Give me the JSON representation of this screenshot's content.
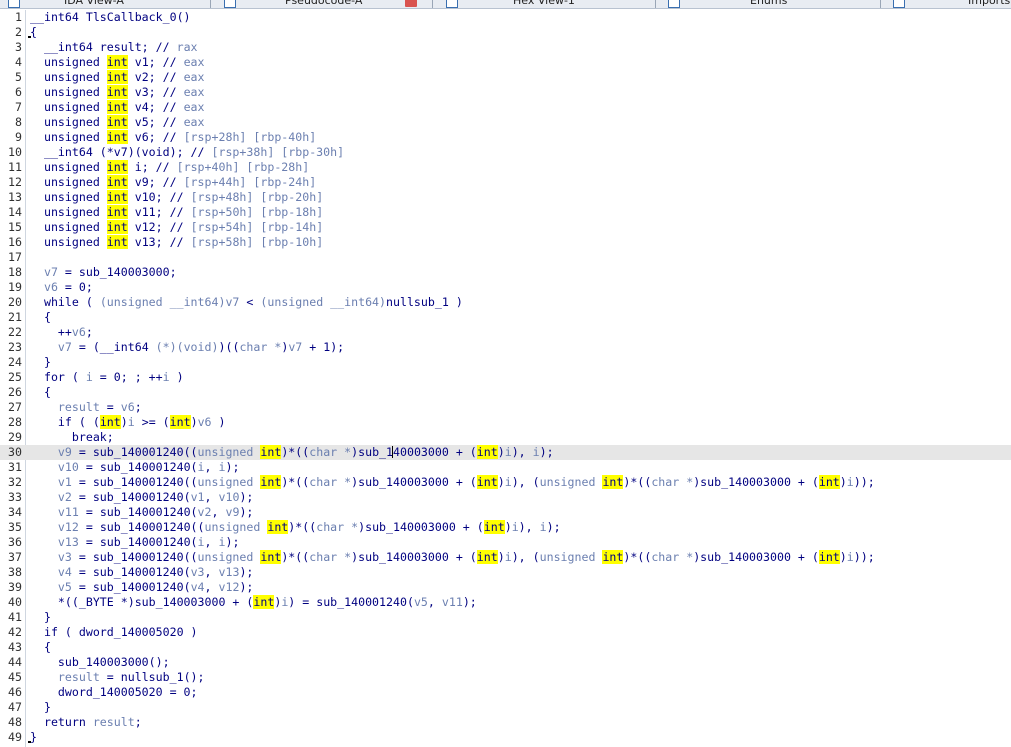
{
  "tabs": [
    {
      "label": "IDA View-A"
    },
    {
      "label": "Pseudocode-A"
    },
    {
      "label": "Hex View-1"
    },
    {
      "label": "Enums"
    },
    {
      "label": "Imports"
    }
  ],
  "highlighted_line": 30,
  "code_lines": [
    [
      [
        "k",
        "__int64 TlsCallback_0()"
      ]
    ],
    [
      [
        "k",
        "{"
      ]
    ],
    [
      [
        "k",
        "  __int64 result; // "
      ],
      [
        "v",
        "rax"
      ]
    ],
    [
      [
        "k",
        "  unsigned "
      ],
      [
        "i",
        "int"
      ],
      [
        "k",
        " v1; // "
      ],
      [
        "v",
        "eax"
      ]
    ],
    [
      [
        "k",
        "  unsigned "
      ],
      [
        "i",
        "int"
      ],
      [
        "k",
        " v2; // "
      ],
      [
        "v",
        "eax"
      ]
    ],
    [
      [
        "k",
        "  unsigned "
      ],
      [
        "i",
        "int"
      ],
      [
        "k",
        " v3; // "
      ],
      [
        "v",
        "eax"
      ]
    ],
    [
      [
        "k",
        "  unsigned "
      ],
      [
        "i",
        "int"
      ],
      [
        "k",
        " v4; // "
      ],
      [
        "v",
        "eax"
      ]
    ],
    [
      [
        "k",
        "  unsigned "
      ],
      [
        "i",
        "int"
      ],
      [
        "k",
        " v5; // "
      ],
      [
        "v",
        "eax"
      ]
    ],
    [
      [
        "k",
        "  unsigned "
      ],
      [
        "i",
        "int"
      ],
      [
        "k",
        " v6; // "
      ],
      [
        "v",
        "[rsp+28h] [rbp-40h]"
      ]
    ],
    [
      [
        "k",
        "  __int64 (*v7)(void); // "
      ],
      [
        "v",
        "[rsp+38h] [rbp-30h]"
      ]
    ],
    [
      [
        "k",
        "  unsigned "
      ],
      [
        "i",
        "int"
      ],
      [
        "k",
        " i; // "
      ],
      [
        "v",
        "[rsp+40h] [rbp-28h]"
      ]
    ],
    [
      [
        "k",
        "  unsigned "
      ],
      [
        "i",
        "int"
      ],
      [
        "k",
        " v9; // "
      ],
      [
        "v",
        "[rsp+44h] [rbp-24h]"
      ]
    ],
    [
      [
        "k",
        "  unsigned "
      ],
      [
        "i",
        "int"
      ],
      [
        "k",
        " v10; // "
      ],
      [
        "v",
        "[rsp+48h] [rbp-20h]"
      ]
    ],
    [
      [
        "k",
        "  unsigned "
      ],
      [
        "i",
        "int"
      ],
      [
        "k",
        " v11; // "
      ],
      [
        "v",
        "[rsp+50h] [rbp-18h]"
      ]
    ],
    [
      [
        "k",
        "  unsigned "
      ],
      [
        "i",
        "int"
      ],
      [
        "k",
        " v12; // "
      ],
      [
        "v",
        "[rsp+54h] [rbp-14h]"
      ]
    ],
    [
      [
        "k",
        "  unsigned "
      ],
      [
        "i",
        "int"
      ],
      [
        "k",
        " v13; // "
      ],
      [
        "v",
        "[rsp+58h] [rbp-10h]"
      ]
    ],
    [
      [
        "k",
        ""
      ]
    ],
    [
      [
        "v",
        "  v7"
      ],
      [
        "k",
        " = sub_140003000;"
      ]
    ],
    [
      [
        "v",
        "  v6"
      ],
      [
        "k",
        " = 0;"
      ]
    ],
    [
      [
        "k",
        "  while ( "
      ],
      [
        "v",
        "(unsigned __int64)v7"
      ],
      [
        "k",
        " < "
      ],
      [
        "v",
        "(unsigned __int64)"
      ],
      [
        "k",
        "nullsub_1 )"
      ]
    ],
    [
      [
        "k",
        "  {"
      ]
    ],
    [
      [
        "k",
        "    ++"
      ],
      [
        "v",
        "v6"
      ],
      [
        "k",
        ";"
      ]
    ],
    [
      [
        "v",
        "    v7"
      ],
      [
        "k",
        " = (__int64 "
      ],
      [
        "v",
        "(*)(void)"
      ],
      [
        "k",
        ")(("
      ],
      [
        "v",
        "char *"
      ],
      [
        "k",
        ")"
      ],
      [
        "v",
        "v7"
      ],
      [
        "k",
        " + 1);"
      ]
    ],
    [
      [
        "k",
        "  }"
      ]
    ],
    [
      [
        "k",
        "  for ( "
      ],
      [
        "v",
        "i"
      ],
      [
        "k",
        " = 0; ; ++"
      ],
      [
        "v",
        "i"
      ],
      [
        "k",
        " )"
      ]
    ],
    [
      [
        "k",
        "  {"
      ]
    ],
    [
      [
        "v",
        "    result"
      ],
      [
        "k",
        " = "
      ],
      [
        "v",
        "v6"
      ],
      [
        "k",
        ";"
      ]
    ],
    [
      [
        "k",
        "    if ( ("
      ],
      [
        "i",
        "int"
      ],
      [
        "k",
        ")"
      ],
      [
        "v",
        "i"
      ],
      [
        "k",
        " >= ("
      ],
      [
        "i",
        "int"
      ],
      [
        "k",
        ")"
      ],
      [
        "v",
        "v6"
      ],
      [
        "k",
        " )"
      ]
    ],
    [
      [
        "k",
        "      break;"
      ]
    ],
    [
      [
        "v",
        "    v9"
      ],
      [
        "k",
        " = sub_140001240(("
      ],
      [
        "v",
        "unsigned "
      ],
      [
        "i",
        "int"
      ],
      [
        "k",
        ")*(("
      ],
      [
        "v",
        "char *"
      ],
      [
        "k",
        ")sub_1"
      ],
      [
        "caret",
        ""
      ],
      [
        "k",
        "40003000 + ("
      ],
      [
        "i",
        "int"
      ],
      [
        "k",
        ")"
      ],
      [
        "v",
        "i"
      ],
      [
        "k",
        "), "
      ],
      [
        "v",
        "i"
      ],
      [
        "k",
        ");"
      ]
    ],
    [
      [
        "v",
        "    v10"
      ],
      [
        "k",
        " = sub_140001240("
      ],
      [
        "v",
        "i"
      ],
      [
        "k",
        ", "
      ],
      [
        "v",
        "i"
      ],
      [
        "k",
        ");"
      ]
    ],
    [
      [
        "v",
        "    v1"
      ],
      [
        "k",
        " = sub_140001240(("
      ],
      [
        "v",
        "unsigned "
      ],
      [
        "i",
        "int"
      ],
      [
        "k",
        ")*(("
      ],
      [
        "v",
        "char *"
      ],
      [
        "k",
        ")sub_140003000 + ("
      ],
      [
        "i",
        "int"
      ],
      [
        "k",
        ")"
      ],
      [
        "v",
        "i"
      ],
      [
        "k",
        "), ("
      ],
      [
        "v",
        "unsigned "
      ],
      [
        "i",
        "int"
      ],
      [
        "k",
        ")*(("
      ],
      [
        "v",
        "char *"
      ],
      [
        "k",
        ")sub_140003000 + ("
      ],
      [
        "i",
        "int"
      ],
      [
        "k",
        ")"
      ],
      [
        "v",
        "i"
      ],
      [
        "k",
        "));"
      ]
    ],
    [
      [
        "v",
        "    v2"
      ],
      [
        "k",
        " = sub_140001240("
      ],
      [
        "v",
        "v1"
      ],
      [
        "k",
        ", "
      ],
      [
        "v",
        "v10"
      ],
      [
        "k",
        ");"
      ]
    ],
    [
      [
        "v",
        "    v11"
      ],
      [
        "k",
        " = sub_140001240("
      ],
      [
        "v",
        "v2"
      ],
      [
        "k",
        ", "
      ],
      [
        "v",
        "v9"
      ],
      [
        "k",
        ");"
      ]
    ],
    [
      [
        "v",
        "    v12"
      ],
      [
        "k",
        " = sub_140001240(("
      ],
      [
        "v",
        "unsigned "
      ],
      [
        "i",
        "int"
      ],
      [
        "k",
        ")*(("
      ],
      [
        "v",
        "char *"
      ],
      [
        "k",
        ")sub_140003000 + ("
      ],
      [
        "i",
        "int"
      ],
      [
        "k",
        ")"
      ],
      [
        "v",
        "i"
      ],
      [
        "k",
        "), "
      ],
      [
        "v",
        "i"
      ],
      [
        "k",
        ");"
      ]
    ],
    [
      [
        "v",
        "    v13"
      ],
      [
        "k",
        " = sub_140001240("
      ],
      [
        "v",
        "i"
      ],
      [
        "k",
        ", "
      ],
      [
        "v",
        "i"
      ],
      [
        "k",
        ");"
      ]
    ],
    [
      [
        "v",
        "    v3"
      ],
      [
        "k",
        " = sub_140001240(("
      ],
      [
        "v",
        "unsigned "
      ],
      [
        "i",
        "int"
      ],
      [
        "k",
        ")*(("
      ],
      [
        "v",
        "char *"
      ],
      [
        "k",
        ")sub_140003000 + ("
      ],
      [
        "i",
        "int"
      ],
      [
        "k",
        ")"
      ],
      [
        "v",
        "i"
      ],
      [
        "k",
        "), ("
      ],
      [
        "v",
        "unsigned "
      ],
      [
        "i",
        "int"
      ],
      [
        "k",
        ")*(("
      ],
      [
        "v",
        "char *"
      ],
      [
        "k",
        ")sub_140003000 + ("
      ],
      [
        "i",
        "int"
      ],
      [
        "k",
        ")"
      ],
      [
        "v",
        "i"
      ],
      [
        "k",
        "));"
      ]
    ],
    [
      [
        "v",
        "    v4"
      ],
      [
        "k",
        " = sub_140001240("
      ],
      [
        "v",
        "v3"
      ],
      [
        "k",
        ", "
      ],
      [
        "v",
        "v13"
      ],
      [
        "k",
        ");"
      ]
    ],
    [
      [
        "v",
        "    v5"
      ],
      [
        "k",
        " = sub_140001240("
      ],
      [
        "v",
        "v4"
      ],
      [
        "k",
        ", "
      ],
      [
        "v",
        "v12"
      ],
      [
        "k",
        ");"
      ]
    ],
    [
      [
        "k",
        "    *((_BYTE *)sub_140003000 + ("
      ],
      [
        "i",
        "int"
      ],
      [
        "k",
        ")"
      ],
      [
        "v",
        "i"
      ],
      [
        "k",
        ") = sub_140001240("
      ],
      [
        "v",
        "v5"
      ],
      [
        "k",
        ", "
      ],
      [
        "v",
        "v11"
      ],
      [
        "k",
        ");"
      ]
    ],
    [
      [
        "k",
        "  }"
      ]
    ],
    [
      [
        "k",
        "  if ( dword_140005020 )"
      ]
    ],
    [
      [
        "k",
        "  {"
      ]
    ],
    [
      [
        "k",
        "    sub_140003000();"
      ]
    ],
    [
      [
        "v",
        "    result"
      ],
      [
        "k",
        " = nullsub_1();"
      ]
    ],
    [
      [
        "k",
        "    dword_140005020 = 0;"
      ]
    ],
    [
      [
        "k",
        "  }"
      ]
    ],
    [
      [
        "k",
        "  return "
      ],
      [
        "v",
        "result"
      ],
      [
        "k",
        ";"
      ]
    ],
    [
      [
        "k",
        "}"
      ]
    ]
  ]
}
